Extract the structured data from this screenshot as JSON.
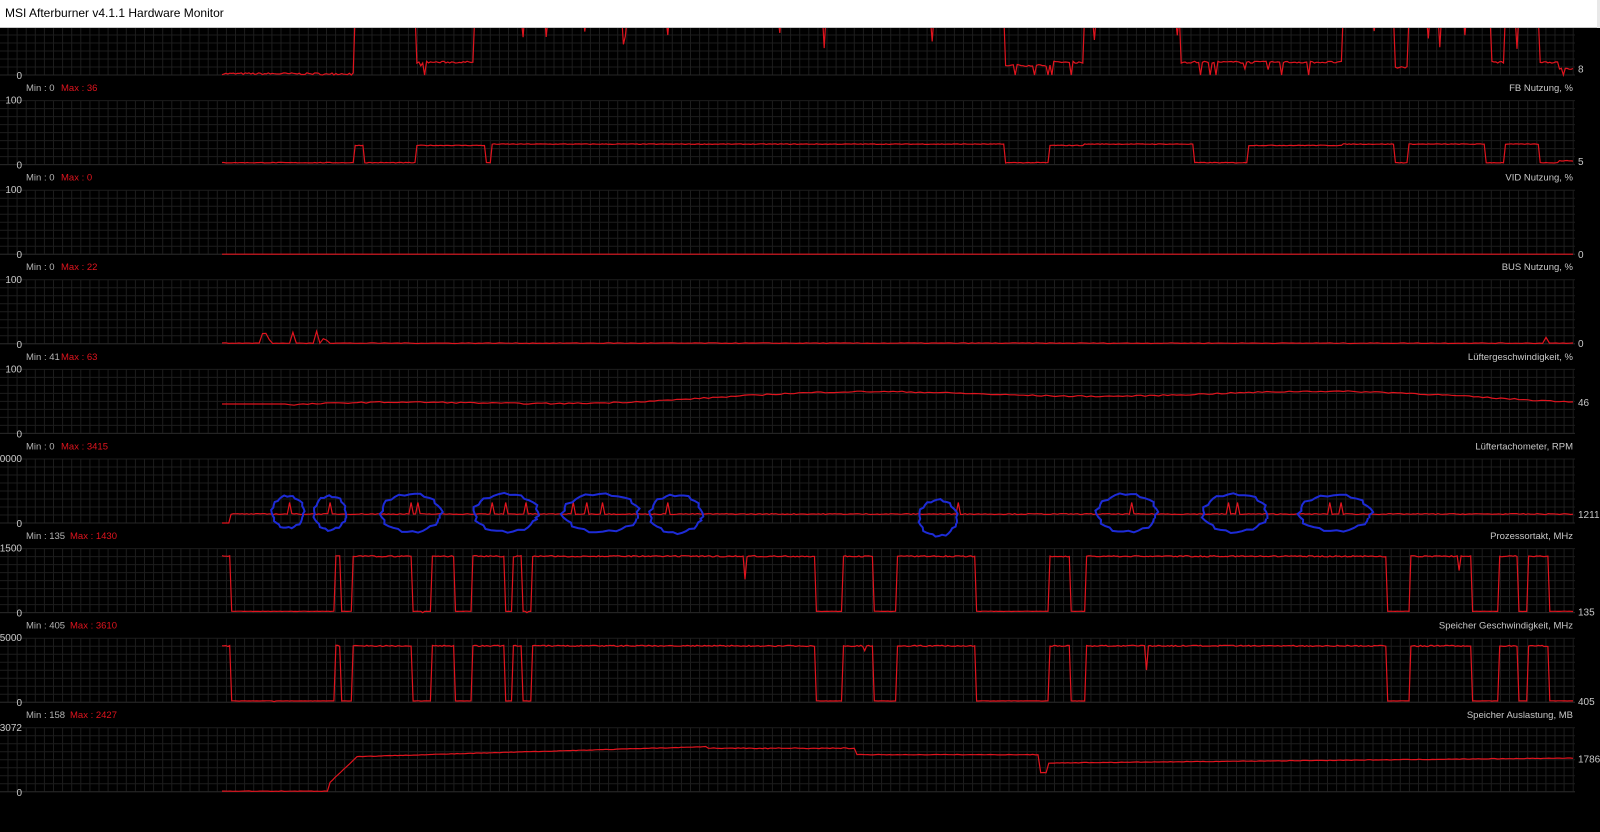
{
  "window": {
    "title": "MSI Afterburner v4.1.1 Hardware Monitor"
  },
  "colors": {
    "background": "#000000",
    "grid": "#1d1d1d",
    "grid_major": "#262626",
    "trace": "#e0141e",
    "label": "#c8c8c8",
    "min_label": "#b4b4b4",
    "max_label": "#e0141e",
    "annotation": "#1d2bd6"
  },
  "panels": [
    {
      "id": "fb",
      "name": "FB Nutzung, %",
      "min_label": "Min : 0",
      "max_label": "Max : 36",
      "y_top": "",
      "y_bottom": "0",
      "current": "8",
      "ymax": 100,
      "pattern": "fb"
    },
    {
      "id": "vid",
      "name": "VID Nutzung, %",
      "min_label": "Min : 0",
      "max_label": "Max : 0",
      "y_top": "100",
      "y_bottom": "0",
      "current": "5",
      "ymax": 100,
      "pattern": "vid"
    },
    {
      "id": "bus",
      "name": "BUS Nutzung, %",
      "min_label": "Min : 0",
      "max_label": "Max : 22",
      "y_top": "100",
      "y_bottom": "0",
      "current": "0",
      "ymax": 100,
      "pattern": "flat"
    },
    {
      "id": "fan",
      "name": "Lüftergeschwindigkeit, %",
      "min_label": "Min : 41",
      "max_label": "Max : 63",
      "y_top": "100",
      "y_bottom": "0",
      "current": "0",
      "ymax": 100,
      "pattern": "bus"
    },
    {
      "id": "tach",
      "name": "Lüftertachometer, RPM",
      "min_label": "Min : 0",
      "max_label": "Max : 3415",
      "y_top": "100",
      "y_bottom": "0",
      "current": "46",
      "ymax": 100,
      "pattern": "fan"
    },
    {
      "id": "cpu",
      "name": "Prozessortakt, MHz",
      "min_label": "Min : 135",
      "max_label": "Max : 1430",
      "y_top": "0000",
      "y_bottom": "0",
      "current": "1211",
      "ymax": 100,
      "pattern": "tach"
    },
    {
      "id": "memclk",
      "name": "Speicher Geschwindigkeit, MHz",
      "min_label": "Min : 405",
      "max_label": "Max : 3610",
      "y_top": "1500",
      "y_bottom": "0",
      "current": "135",
      "ymax": 1500,
      "pattern": "clock"
    },
    {
      "id": "memuse",
      "name": "Speicher Auslastung, MB",
      "min_label": "Min : 158",
      "max_label": "Max : 2427",
      "y_top": "5000",
      "y_bottom": "0",
      "current": "405",
      "ymax": 5000,
      "pattern": "clock"
    },
    {
      "id": "last",
      "name": "",
      "min_label": "",
      "max_label": "",
      "y_top": "3072",
      "y_bottom": "0",
      "current": "1786",
      "ymax": 3072,
      "pattern": "mem"
    }
  ]
}
